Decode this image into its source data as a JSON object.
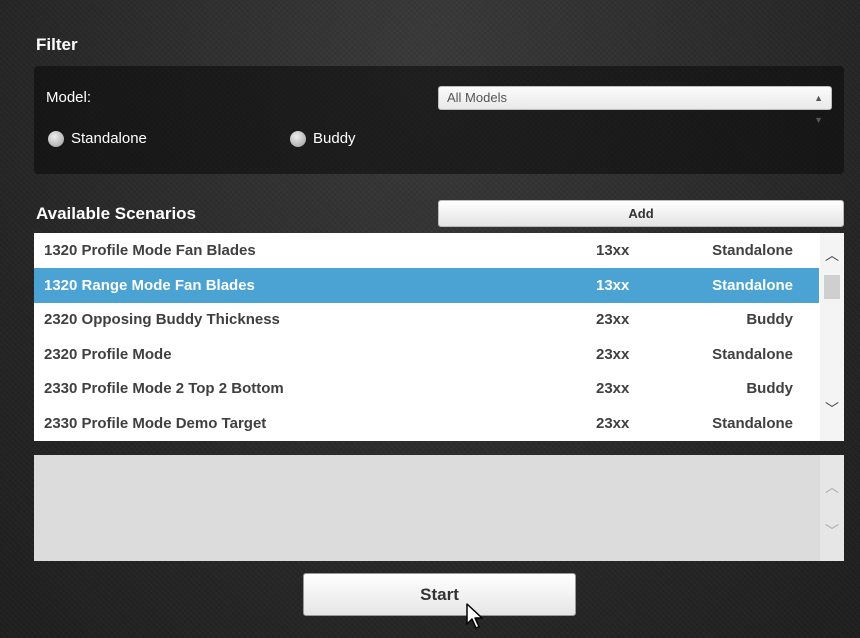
{
  "filter": {
    "title": "Filter",
    "model_label": "Model:",
    "model_value": "All Models",
    "radios": [
      {
        "label": "Standalone",
        "checked": false
      },
      {
        "label": "Buddy",
        "checked": false
      }
    ]
  },
  "scenarios": {
    "title": "Available Scenarios",
    "add_label": "Add",
    "rows": [
      {
        "name": "1320 Profile Mode Fan Blades",
        "model": "13xx",
        "type": "Standalone",
        "selected": false
      },
      {
        "name": "1320 Range Mode Fan Blades",
        "model": "13xx",
        "type": "Standalone",
        "selected": true
      },
      {
        "name": "2320 Opposing Buddy Thickness",
        "model": "23xx",
        "type": "Buddy",
        "selected": false
      },
      {
        "name": "2320 Profile Mode",
        "model": "23xx",
        "type": "Standalone",
        "selected": false
      },
      {
        "name": "2330 Profile Mode 2 Top 2 Bottom",
        "model": "23xx",
        "type": "Buddy",
        "selected": false
      },
      {
        "name": "2330 Profile Mode Demo Target",
        "model": "23xx",
        "type": "Standalone",
        "selected": false
      }
    ]
  },
  "description": "",
  "start_label": "Start",
  "icons": {
    "select_arrows": "updown-arrows-icon",
    "scroll_up": "chevron-up-icon",
    "scroll_down": "chevron-down-icon",
    "cursor": "mouse-pointer-icon"
  },
  "colors": {
    "selection": "#4aa3d3",
    "background": "#2a2a2a"
  }
}
